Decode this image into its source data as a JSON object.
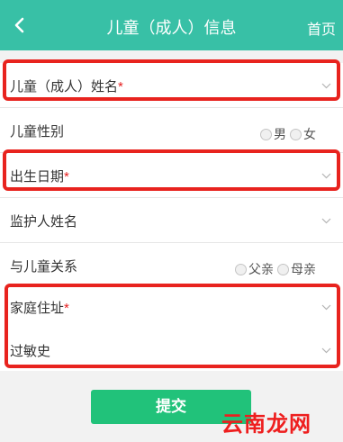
{
  "header": {
    "title": "儿童（成人）信息",
    "home_label": "首页"
  },
  "form": {
    "fields": [
      {
        "label": "儿童（成人）姓名",
        "required": "*"
      },
      {
        "label": "儿童性别",
        "options": [
          "男",
          "女"
        ]
      },
      {
        "label": "出生日期",
        "required": "*"
      },
      {
        "label": "监护人姓名"
      },
      {
        "label": "与儿童关系",
        "options": [
          "父亲",
          "母亲"
        ]
      },
      {
        "label": "家庭住址",
        "required": "*"
      },
      {
        "label": "过敏史"
      }
    ]
  },
  "submit_label": "提交",
  "watermark": "云南龙网",
  "colors": {
    "header": "#38c0a6",
    "submit": "#21c27a",
    "highlight": "#e8231e",
    "required": "#e62020"
  }
}
